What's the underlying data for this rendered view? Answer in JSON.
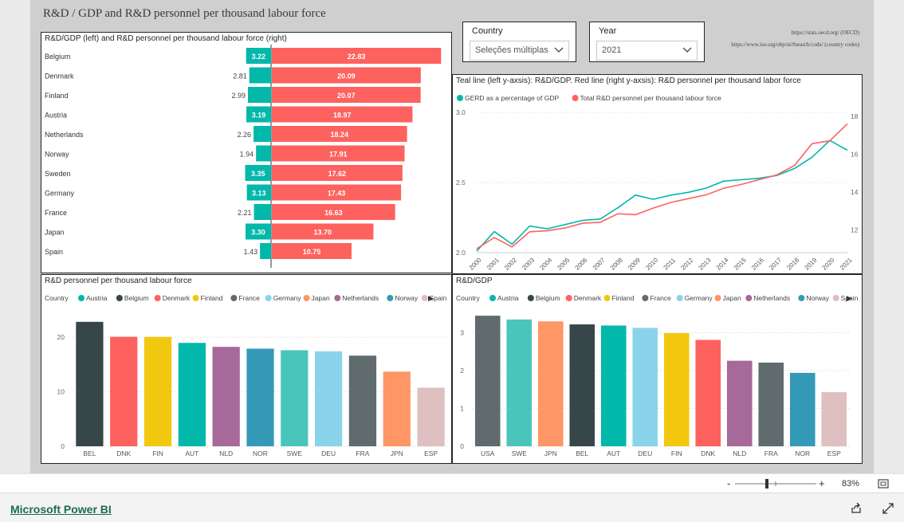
{
  "report": {
    "title": "R&D / GDP and R&D personnel per thousand labour force",
    "source_1": "https://stats.oecd.org/ (OECD)",
    "source_2": "https://www.iso.org/obp/ui/#search/code/ (country codes)"
  },
  "slicers": {
    "country": {
      "label": "Country",
      "value": "Seleções múltiplas"
    },
    "year": {
      "label": "Year",
      "value": "2021"
    }
  },
  "footer": {
    "brand": "Microsoft Power BI",
    "zoom": "83%",
    "zoom_minus": "-",
    "zoom_plus": "+"
  },
  "colors": {
    "teal": "#01b8aa",
    "red": "#fd625e",
    "canvas": "#cfcfcf",
    "brand": "#1c6b55"
  },
  "chart_data": [
    {
      "id": "diverging",
      "type": "bar",
      "title": "R&D/GDP (left) and R&D personnel per thousand labour force (right)",
      "categories": [
        "Belgium",
        "Denmark",
        "Finland",
        "Austria",
        "Netherlands",
        "Norway",
        "Sweden",
        "Germany",
        "France",
        "Japan",
        "Spain"
      ],
      "series": [
        {
          "name": "R&D/GDP",
          "values": [
            3.22,
            2.81,
            2.99,
            3.19,
            2.26,
            1.94,
            3.35,
            3.13,
            2.21,
            3.3,
            1.43
          ],
          "labels": [
            "3.22",
            "2.81",
            "2.99",
            "3.19",
            "2.26",
            "1.94",
            "3.35",
            "3.13",
            "2.21",
            "3.30",
            "1.43"
          ],
          "color": "#01b8aa"
        },
        {
          "name": "R&D personnel per thousand labour force",
          "values": [
            22.83,
            20.09,
            20.07,
            18.97,
            18.24,
            17.91,
            17.62,
            17.43,
            16.63,
            13.7,
            10.75
          ],
          "labels": [
            "22.83",
            "20.09",
            "20.07",
            "18.97",
            "18.24",
            "17.91",
            "17.62",
            "17.43",
            "16.63",
            "13.70",
            "10.75"
          ],
          "color": "#fd625e"
        }
      ]
    },
    {
      "id": "trend",
      "type": "line",
      "title": "Teal line (left y-axsis): R&D/GDP. Red line (right y-axsis): R&D personnel per thousand labor force",
      "x": [
        "2000",
        "2001",
        "2002",
        "2003",
        "2004",
        "2005",
        "2006",
        "2007",
        "2008",
        "2009",
        "2010",
        "2011",
        "2012",
        "2013",
        "2014",
        "2015",
        "2016",
        "2017",
        "2018",
        "2019",
        "2020",
        "2021"
      ],
      "series": [
        {
          "name": "GERD as a percentage of GDP",
          "axis": "left",
          "color": "#01b8aa",
          "values": [
            2.01,
            2.15,
            2.06,
            2.19,
            2.17,
            2.2,
            2.23,
            2.24,
            2.32,
            2.41,
            2.38,
            2.41,
            2.43,
            2.46,
            2.51,
            2.52,
            2.53,
            2.55,
            2.6,
            2.68,
            2.8,
            2.73
          ]
        },
        {
          "name": "Total R&D personnel per thousand labour force",
          "axis": "right",
          "color": "#fd625e",
          "values": [
            11.0,
            11.6,
            11.1,
            11.9,
            11.95,
            12.1,
            12.35,
            12.4,
            12.85,
            12.8,
            13.15,
            13.45,
            13.65,
            13.85,
            14.2,
            14.4,
            14.65,
            14.9,
            15.4,
            16.55,
            16.7,
            17.6
          ]
        }
      ],
      "ylim_left": [
        2.0,
        3.0
      ],
      "yticks_left": [
        "2.0",
        "2.5",
        "3.0"
      ],
      "ylim_right": [
        10.8,
        18.2
      ],
      "yticks_right": [
        "12",
        "14",
        "16",
        "18"
      ],
      "legend": "top-left"
    },
    {
      "id": "personnel",
      "type": "bar",
      "title": "R&D personnel per thousand labour force",
      "legend_title": "Country",
      "legend": [
        {
          "name": "Austria",
          "color": "#01b8aa"
        },
        {
          "name": "Belgium",
          "color": "#374649"
        },
        {
          "name": "Denmark",
          "color": "#fd625e"
        },
        {
          "name": "Finland",
          "color": "#f2c80f"
        },
        {
          "name": "France",
          "color": "#5f6b6d"
        },
        {
          "name": "Germany",
          "color": "#8ad4eb"
        },
        {
          "name": "Japan",
          "color": "#fe9666"
        },
        {
          "name": "Netherlands",
          "color": "#a66999"
        },
        {
          "name": "Norway",
          "color": "#3599b8"
        },
        {
          "name": "Spain",
          "color": "#dfbfbf"
        }
      ],
      "legend_more": "▶",
      "categories": [
        "BEL",
        "DNK",
        "FIN",
        "AUT",
        "NLD",
        "NOR",
        "SWE",
        "DEU",
        "FRA",
        "JPN",
        "ESP"
      ],
      "values": [
        22.83,
        20.09,
        20.07,
        18.97,
        18.24,
        17.91,
        17.62,
        17.43,
        16.63,
        13.7,
        10.75
      ],
      "colors": [
        "#374649",
        "#fd625e",
        "#f2c80f",
        "#01b8aa",
        "#a66999",
        "#3599b8",
        "#4ac5bb",
        "#8ad4eb",
        "#5f6b6d",
        "#fe9666",
        "#dfbfbf"
      ],
      "ylim": [
        0,
        25
      ],
      "yticks": [
        "0",
        "10",
        "20"
      ]
    },
    {
      "id": "gdp",
      "type": "bar",
      "title": "R&D/GDP",
      "legend_title": "Country",
      "legend": [
        {
          "name": "Austria",
          "color": "#01b8aa"
        },
        {
          "name": "Belgium",
          "color": "#374649"
        },
        {
          "name": "Denmark",
          "color": "#fd625e"
        },
        {
          "name": "Finland",
          "color": "#f2c80f"
        },
        {
          "name": "France",
          "color": "#5f6b6d"
        },
        {
          "name": "Germany",
          "color": "#8ad4eb"
        },
        {
          "name": "Japan",
          "color": "#fe9666"
        },
        {
          "name": "Netherlands",
          "color": "#a66999"
        },
        {
          "name": "Norway",
          "color": "#3599b8"
        },
        {
          "name": "Spain",
          "color": "#dfbfbf"
        }
      ],
      "legend_more": "▶",
      "categories": [
        "USA",
        "SWE",
        "JPN",
        "BEL",
        "AUT",
        "DEU",
        "FIN",
        "DNK",
        "NLD",
        "FRA",
        "NOR",
        "ESP"
      ],
      "values": [
        3.45,
        3.35,
        3.3,
        3.22,
        3.19,
        3.13,
        2.99,
        2.81,
        2.26,
        2.21,
        1.94,
        1.43
      ],
      "colors": [
        "#5f6b6d",
        "#4ac5bb",
        "#fe9666",
        "#374649",
        "#01b8aa",
        "#8ad4eb",
        "#f2c80f",
        "#fd625e",
        "#a66999",
        "#5f6b6d",
        "#3599b8",
        "#dfbfbf"
      ],
      "ylim": [
        0,
        3.6
      ],
      "yticks": [
        "0",
        "1",
        "2",
        "3"
      ]
    }
  ]
}
